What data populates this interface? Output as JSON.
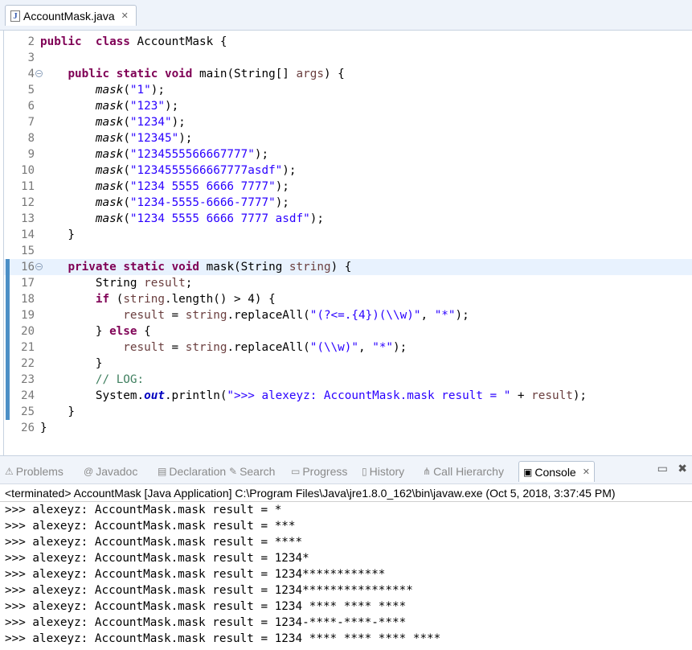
{
  "editor_tab": {
    "title": "AccountMask.java",
    "icon": "java-file-icon",
    "close": "✕"
  },
  "code_lines": [
    {
      "n": "2",
      "segs": [
        [
          "kw",
          "public"
        ],
        [
          "",
          "  "
        ],
        [
          "kw",
          "class"
        ],
        [
          "",
          " AccountMask {"
        ]
      ]
    },
    {
      "n": "3",
      "segs": []
    },
    {
      "n": "4",
      "fold": true,
      "segs": [
        [
          "",
          "    "
        ],
        [
          "kw",
          "public"
        ],
        [
          "",
          " "
        ],
        [
          "kw",
          "static"
        ],
        [
          "",
          " "
        ],
        [
          "kw",
          "void"
        ],
        [
          "",
          " main(String[] "
        ],
        [
          "var",
          "args"
        ],
        [
          "",
          ") {"
        ]
      ]
    },
    {
      "n": "5",
      "segs": [
        [
          "",
          "        "
        ],
        [
          "it",
          "mask"
        ],
        [
          "",
          "("
        ],
        [
          "str",
          "\"1\""
        ],
        [
          "",
          ");"
        ]
      ]
    },
    {
      "n": "6",
      "segs": [
        [
          "",
          "        "
        ],
        [
          "it",
          "mask"
        ],
        [
          "",
          "("
        ],
        [
          "str",
          "\"123\""
        ],
        [
          "",
          ");"
        ]
      ]
    },
    {
      "n": "7",
      "segs": [
        [
          "",
          "        "
        ],
        [
          "it",
          "mask"
        ],
        [
          "",
          "("
        ],
        [
          "str",
          "\"1234\""
        ],
        [
          "",
          ");"
        ]
      ]
    },
    {
      "n": "8",
      "segs": [
        [
          "",
          "        "
        ],
        [
          "it",
          "mask"
        ],
        [
          "",
          "("
        ],
        [
          "str",
          "\"12345\""
        ],
        [
          "",
          ");"
        ]
      ]
    },
    {
      "n": "9",
      "segs": [
        [
          "",
          "        "
        ],
        [
          "it",
          "mask"
        ],
        [
          "",
          "("
        ],
        [
          "str",
          "\"1234555566667777\""
        ],
        [
          "",
          ");"
        ]
      ]
    },
    {
      "n": "10",
      "segs": [
        [
          "",
          "        "
        ],
        [
          "it",
          "mask"
        ],
        [
          "",
          "("
        ],
        [
          "str",
          "\"1234555566667777asdf\""
        ],
        [
          "",
          ");"
        ]
      ]
    },
    {
      "n": "11",
      "segs": [
        [
          "",
          "        "
        ],
        [
          "it",
          "mask"
        ],
        [
          "",
          "("
        ],
        [
          "str",
          "\"1234 5555 6666 7777\""
        ],
        [
          "",
          ");"
        ]
      ]
    },
    {
      "n": "12",
      "segs": [
        [
          "",
          "        "
        ],
        [
          "it",
          "mask"
        ],
        [
          "",
          "("
        ],
        [
          "str",
          "\"1234-5555-6666-7777\""
        ],
        [
          "",
          ");"
        ]
      ]
    },
    {
      "n": "13",
      "segs": [
        [
          "",
          "        "
        ],
        [
          "it",
          "mask"
        ],
        [
          "",
          "("
        ],
        [
          "str",
          "\"1234 5555 6666 7777 asdf\""
        ],
        [
          "",
          ");"
        ]
      ]
    },
    {
      "n": "14",
      "segs": [
        [
          "",
          "    }"
        ]
      ]
    },
    {
      "n": "15",
      "segs": []
    },
    {
      "n": "16",
      "fold": true,
      "hl": true,
      "mark": true,
      "segs": [
        [
          "",
          "    "
        ],
        [
          "kw",
          "private"
        ],
        [
          "",
          " "
        ],
        [
          "kw",
          "static"
        ],
        [
          "",
          " "
        ],
        [
          "kw",
          "void"
        ],
        [
          "",
          " mask(String "
        ],
        [
          "var",
          "string"
        ],
        [
          "",
          ") {"
        ]
      ]
    },
    {
      "n": "17",
      "mark": true,
      "segs": [
        [
          "",
          "        String "
        ],
        [
          "var",
          "result"
        ],
        [
          "",
          ";"
        ]
      ]
    },
    {
      "n": "18",
      "mark": true,
      "segs": [
        [
          "",
          "        "
        ],
        [
          "kw",
          "if"
        ],
        [
          "",
          " ("
        ],
        [
          "var",
          "string"
        ],
        [
          "",
          ".length() > 4) {"
        ]
      ]
    },
    {
      "n": "19",
      "mark": true,
      "segs": [
        [
          "",
          "            "
        ],
        [
          "var",
          "result"
        ],
        [
          "",
          " = "
        ],
        [
          "var",
          "string"
        ],
        [
          "",
          ".replaceAll("
        ],
        [
          "str",
          "\"(?<=.{4})(\\\\w)\""
        ],
        [
          "",
          ", "
        ],
        [
          "str",
          "\"*\""
        ],
        [
          "",
          ");"
        ]
      ]
    },
    {
      "n": "20",
      "mark": true,
      "segs": [
        [
          "",
          "        } "
        ],
        [
          "kw",
          "else"
        ],
        [
          "",
          " {"
        ]
      ]
    },
    {
      "n": "21",
      "mark": true,
      "segs": [
        [
          "",
          "            "
        ],
        [
          "var",
          "result"
        ],
        [
          "",
          " = "
        ],
        [
          "var",
          "string"
        ],
        [
          "",
          ".replaceAll("
        ],
        [
          "str",
          "\"(\\\\w)\""
        ],
        [
          "",
          ", "
        ],
        [
          "str",
          "\"*\""
        ],
        [
          "",
          ");"
        ]
      ]
    },
    {
      "n": "22",
      "mark": true,
      "segs": [
        [
          "",
          "        }"
        ]
      ]
    },
    {
      "n": "23",
      "mark": true,
      "segs": [
        [
          "",
          "        "
        ],
        [
          "cm",
          "// LOG:"
        ]
      ]
    },
    {
      "n": "24",
      "mark": true,
      "segs": [
        [
          "",
          "        System."
        ],
        [
          "st",
          "out"
        ],
        [
          "",
          ".println("
        ],
        [
          "str",
          "\">>> alexeyz: AccountMask.mask result = \""
        ],
        [
          "",
          " + "
        ],
        [
          "var",
          "result"
        ],
        [
          "",
          ");"
        ]
      ]
    },
    {
      "n": "25",
      "mark": true,
      "segs": [
        [
          "",
          "    }"
        ]
      ]
    },
    {
      "n": "26",
      "segs": [
        [
          "",
          "}"
        ]
      ]
    }
  ],
  "views": {
    "tabs": [
      {
        "label": "Problems",
        "icon": "problems-icon",
        "glyph": "⚠",
        "active": false
      },
      {
        "label": "Javadoc",
        "icon": "javadoc-icon",
        "glyph": "@",
        "active": false
      },
      {
        "label": "Declaration",
        "icon": "declaration-icon",
        "glyph": "▤",
        "active": false
      },
      {
        "label": "Search",
        "icon": "search-icon",
        "glyph": "✎",
        "active": false
      },
      {
        "label": "Progress",
        "icon": "progress-icon",
        "glyph": "▭",
        "active": false
      },
      {
        "label": "History",
        "icon": "history-icon",
        "glyph": "▯",
        "active": false
      },
      {
        "label": "Call Hierarchy",
        "icon": "call-hierarchy-icon",
        "glyph": "⋔",
        "active": false
      },
      {
        "label": "Console",
        "icon": "console-icon",
        "glyph": "▣",
        "active": true,
        "close": "✕"
      }
    ],
    "minimize": "▭",
    "close": "✖"
  },
  "console": {
    "status": "<terminated> AccountMask [Java Application] C:\\Program Files\\Java\\jre1.8.0_162\\bin\\javaw.exe (Oct 5, 2018, 3:37:45 PM)",
    "lines": [
      ">>> alexeyz: AccountMask.mask result = *",
      ">>> alexeyz: AccountMask.mask result = ***",
      ">>> alexeyz: AccountMask.mask result = ****",
      ">>> alexeyz: AccountMask.mask result = 1234*",
      ">>> alexeyz: AccountMask.mask result = 1234************",
      ">>> alexeyz: AccountMask.mask result = 1234****************",
      ">>> alexeyz: AccountMask.mask result = 1234 **** **** ****",
      ">>> alexeyz: AccountMask.mask result = 1234-****-****-****",
      ">>> alexeyz: AccountMask.mask result = 1234 **** **** **** ****"
    ]
  },
  "scroll_left": "<"
}
